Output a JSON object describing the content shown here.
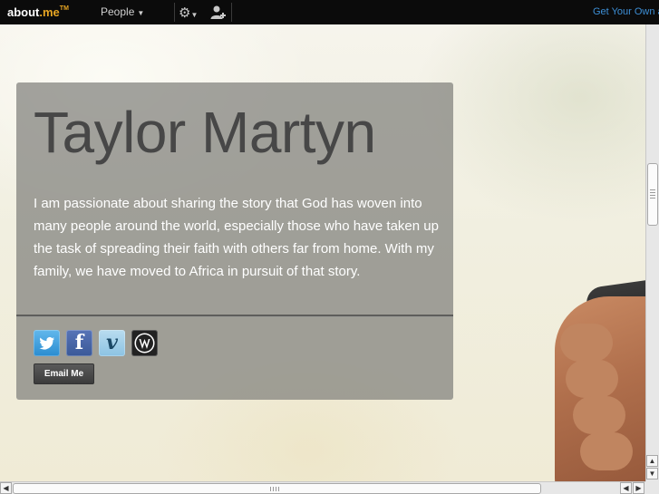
{
  "topbar": {
    "logo_main": "about",
    "logo_tld": ".me",
    "logo_tm": "TM",
    "people_label": "People",
    "get_your_label": "Get Your Own about.me Page"
  },
  "profile": {
    "name": "Taylor Martyn",
    "bio": "I am passionate about sharing the story that God has woven into many people around the world, especially those who have taken up the task of spreading their faith with others far from home. With my family, we have moved to Africa in pursuit of that story.",
    "email_button_label": "Email Me",
    "social_links": [
      {
        "network": "twitter",
        "icon": "twitter-icon",
        "glyph": ""
      },
      {
        "network": "facebook",
        "icon": "facebook-icon",
        "glyph": "f"
      },
      {
        "network": "vimeo",
        "icon": "vimeo-icon",
        "glyph": "v"
      },
      {
        "network": "wordpress",
        "icon": "wordpress-icon",
        "glyph": ""
      }
    ]
  },
  "colors": {
    "topbar_bg": "#0b0b0b",
    "logo_accent": "#e8a623",
    "link_blue": "#3d8fd6",
    "card_bg": "rgba(128,128,124,0.72)",
    "name_color": "#474747"
  }
}
